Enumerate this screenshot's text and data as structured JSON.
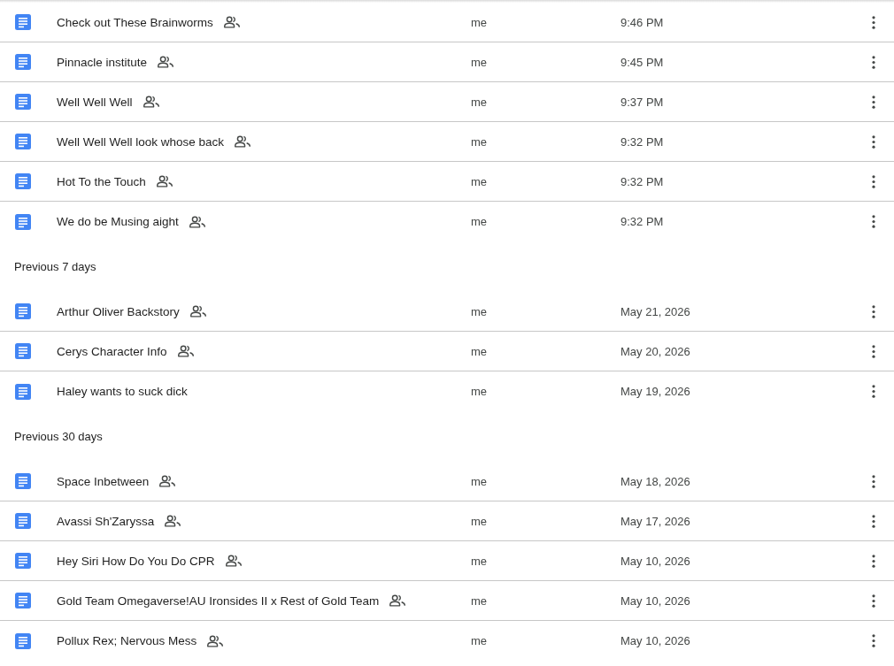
{
  "sections": [
    {
      "rows": [
        {
          "title": "Check out These Brainworms",
          "shared": true,
          "owner": "me",
          "modified": "9:46 PM"
        },
        {
          "title": "Pinnacle institute",
          "shared": true,
          "owner": "me",
          "modified": "9:45 PM"
        },
        {
          "title": "Well Well Well",
          "shared": true,
          "owner": "me",
          "modified": "9:37 PM"
        },
        {
          "title": "Well Well Well look whose back",
          "shared": true,
          "owner": "me",
          "modified": "9:32 PM"
        },
        {
          "title": "Hot To the Touch",
          "shared": true,
          "owner": "me",
          "modified": "9:32 PM"
        },
        {
          "title": "We do be Musing aight",
          "shared": true,
          "owner": "me",
          "modified": "9:32 PM"
        }
      ]
    },
    {
      "heading": "Previous 7 days",
      "rows": [
        {
          "title": "Arthur Oliver Backstory",
          "shared": true,
          "owner": "me",
          "modified": "May 21, 2026"
        },
        {
          "title": "Cerys Character Info",
          "shared": true,
          "owner": "me",
          "modified": "May 20, 2026"
        },
        {
          "title": "Haley wants to suck dick",
          "shared": false,
          "owner": "me",
          "modified": "May 19, 2026"
        }
      ]
    },
    {
      "heading": "Previous 30 days",
      "rows": [
        {
          "title": "Space Inbetween",
          "shared": true,
          "owner": "me",
          "modified": "May 18, 2026"
        },
        {
          "title": "Avassi Sh'Zaryssa",
          "shared": true,
          "owner": "me",
          "modified": "May 17, 2026"
        },
        {
          "title": "Hey Siri How Do You Do CPR",
          "shared": true,
          "owner": "me",
          "modified": "May 10, 2026"
        },
        {
          "title": "Gold Team Omegaverse!AU Ironsides II x Rest of Gold Team",
          "shared": true,
          "owner": "me",
          "modified": "May 10, 2026"
        },
        {
          "title": "Pollux Rex; Nervous Mess",
          "shared": true,
          "owner": "me",
          "modified": "May 10, 2026"
        }
      ]
    }
  ]
}
